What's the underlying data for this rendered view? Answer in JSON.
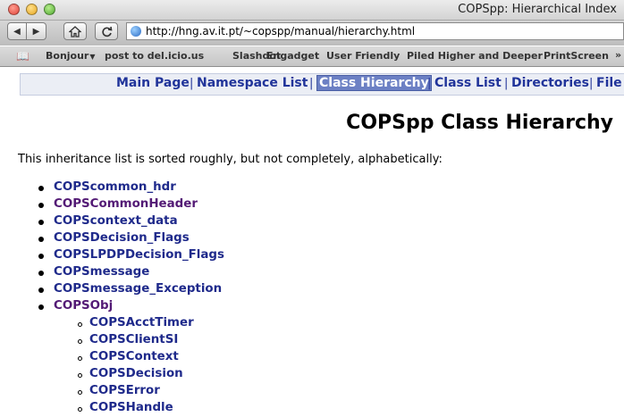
{
  "window": {
    "title": "COPSpp: Hierarchical Index"
  },
  "toolbar": {
    "url": "http://hng.av.it.pt/~copspp/manual/hierarchy.html"
  },
  "bookmarks": {
    "items": [
      "Bonjour",
      "post to del.icio.us",
      "Slashdot",
      "Engadget",
      "User Friendly",
      "Piled Higher and Deeper",
      "PrintScreen"
    ],
    "more": "»"
  },
  "tabs": [
    {
      "label": "Main Page"
    },
    {
      "label": "Namespace List"
    },
    {
      "label": "Class Hierarchy"
    },
    {
      "label": "Class List"
    },
    {
      "label": "Directories"
    },
    {
      "label": "File"
    }
  ],
  "separator": "|",
  "heading": "COPSpp Class Hierarchy",
  "intro": "This inheritance list is sorted roughly, but not completely, alphabetically:",
  "classes": [
    "COPScommon_hdr",
    "COPSCommonHeader",
    "COPScontext_data",
    "COPSDecision_Flags",
    "COPSLPDPDecision_Flags",
    "COPSmessage",
    "COPSmessage_Exception",
    "COPSObj"
  ],
  "subclasses": [
    "COPSAcctTimer",
    "COPSClientSI",
    "COPSContext",
    "COPSDecision",
    "COPSError",
    "COPSHandle"
  ],
  "colors": {
    "link": "#1f2a8b",
    "visited_link": "#531a75",
    "active_tab": "#6c80c4"
  }
}
